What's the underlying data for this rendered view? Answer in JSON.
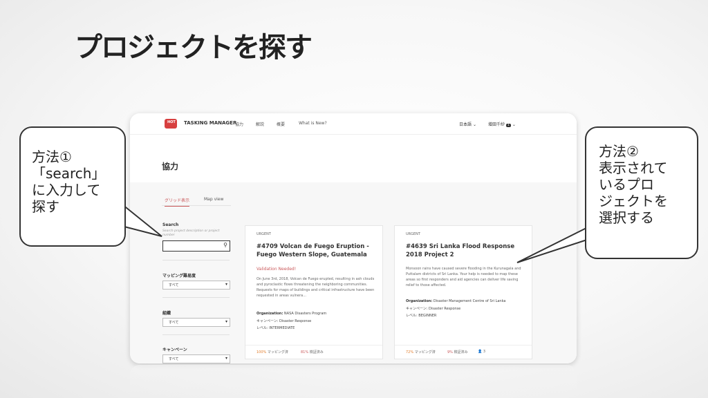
{
  "slide": {
    "title": "プロジェクトを探す"
  },
  "navbar": {
    "logo_text": "HOT",
    "brand": "TASKING MANAGER",
    "items": [
      "協力",
      "解説",
      "概要",
      "What is New?"
    ],
    "language": "日本語",
    "user": "增田千紗",
    "user_badge": "1"
  },
  "page": {
    "heading": "協力"
  },
  "tabs": [
    {
      "label": "グリッド表示",
      "active": true
    },
    {
      "label": "Map view",
      "active": false
    }
  ],
  "sidebar": {
    "search_label": "Search",
    "search_placeholder": "Search project description or project number",
    "difficulty_label": "マッピング難易度",
    "difficulty_value": "すべて",
    "organization_label": "組織",
    "organization_value": "すべて",
    "campaign_label": "キャンペーン",
    "campaign_value": "すべて"
  },
  "cards": [
    {
      "status": "URGENT",
      "title": "#4709 Volcan de Fuego Eruption - Fuego Western Slope, Guatemala",
      "validation": "Validation Needed!",
      "description": "On June 3rd, 2018, Volcan de Fuego erupted, resulting in ash clouds and pyroclastic flows threatening the neighboring communities. Requests for maps of buildings and critical infrastructure have been requested in areas vulnera...",
      "organization_label": "Organization:",
      "organization": "NASA Disasters Program",
      "campaign_label": "キャンペーン:",
      "campaign": "Disaster Response",
      "level_label": "レベル:",
      "level": "INTERMEDIATE",
      "mapped_pct": "100%",
      "mapped_label": "マッピング済",
      "validated_pct": "81%",
      "validated_label": "検証済み",
      "contributors": ""
    },
    {
      "status": "URGENT",
      "title": "#4639 Sri Lanka Flood Response 2018 Project 2",
      "validation": "",
      "description": "Monsoon rains have caused severe flooding in the Kurunagala and Puttalam districts of Sri Lanka. Your help is needed to map these areas so first responders and aid agencies can deliver life saving relief to those affected.",
      "organization_label": "Organization:",
      "organization": "Disaster Management Centre of Sri Lanka",
      "campaign_label": "キャンペーン:",
      "campaign": "Disaster Response",
      "level_label": "レベル:",
      "level": "BEGINNER",
      "mapped_pct": "72%",
      "mapped_label": "マッピング済",
      "validated_pct": "9%",
      "validated_label": "検証済み",
      "contributors": "3"
    }
  ],
  "callouts": {
    "left": "方法①\n「search」\nに入力して\n探す",
    "right": "方法②\n表示されて\nいるプロ\nジェクトを\n選択する"
  },
  "colors": {
    "accent": "#c9585a",
    "mapped": "#e27d2b",
    "logo": "#d73f3f"
  }
}
